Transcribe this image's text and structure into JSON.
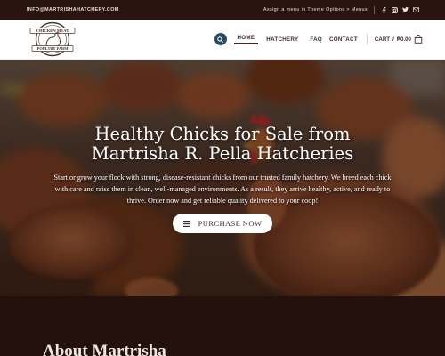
{
  "topbar": {
    "email": "INFO@MARTRISHAHATCHERY.COM",
    "menu_note": "Assign a menu in Theme Options > Menus",
    "social_icons": [
      "facebook-icon",
      "instagram-icon",
      "twitter-icon",
      "email-icon"
    ]
  },
  "header": {
    "logo": {
      "top_text": "CHICKEN MEAT",
      "bottom_text": "POULTRY FARM"
    },
    "nav": [
      "HOME",
      "HATCHERY",
      "FAQ",
      "CONTACT"
    ],
    "cart_label": "CART",
    "cart_sep": "/",
    "cart_total": "₱0.00"
  },
  "hero": {
    "title_line1": "Healthy Chicks for Sale from",
    "title_line2": "Martrisha R. Pella Hatcheries",
    "text": "Start or grow your flock with strong, disease-resistant chicks from our trusted family hatchery. We breed each chick with care and raise them in clean, well-managed environments. As a result, they arrive healthy, active, and ready to thrive. Order now and get reliable quality delivered to your coop!",
    "button_label": "PURCHASE NOW"
  },
  "about": {
    "title": "About Martrisha"
  },
  "colors": {
    "topbar_bg": "#2a1410",
    "nav_text": "#3e2a24",
    "search_bg": "#2c4a5f",
    "about_bg": "#22110c"
  }
}
